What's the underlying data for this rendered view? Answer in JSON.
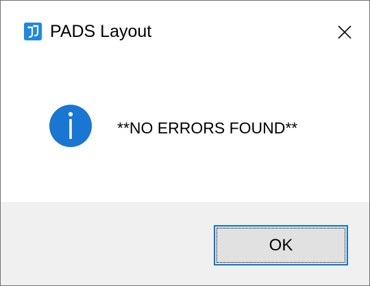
{
  "window": {
    "title": "PADS Layout",
    "app_icon": "pads-app-icon",
    "close_icon": "close-icon"
  },
  "message": {
    "icon": "info-icon",
    "text": "**NO ERRORS FOUND**"
  },
  "buttons": {
    "ok_label": "OK"
  },
  "colors": {
    "accent": "#0078d7",
    "info_icon": "#1976d2",
    "app_icon": "#1e88e5",
    "footer_bg": "#f0f0f0",
    "button_bg": "#e1e1e1"
  }
}
